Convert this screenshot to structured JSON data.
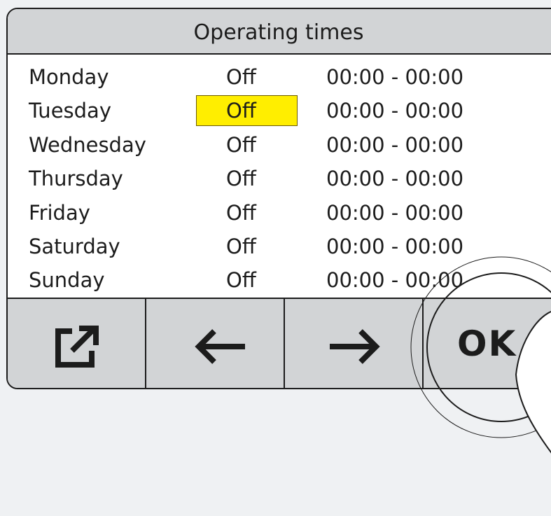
{
  "title": "Operating times",
  "schedule": [
    {
      "day": "Monday",
      "status": "Off",
      "time": "00:00 - 00:00",
      "selected": false
    },
    {
      "day": "Tuesday",
      "status": "Off",
      "time": "00:00 - 00:00",
      "selected": true
    },
    {
      "day": "Wednesday",
      "status": "Off",
      "time": "00:00 - 00:00",
      "selected": false
    },
    {
      "day": "Thursday",
      "status": "Off",
      "time": "00:00 - 00:00",
      "selected": false
    },
    {
      "day": "Friday",
      "status": "Off",
      "time": "00:00 - 00:00",
      "selected": false
    },
    {
      "day": "Saturday",
      "status": "Off",
      "time": "00:00 - 00:00",
      "selected": false
    },
    {
      "day": "Sunday",
      "status": "Off",
      "time": "00:00 - 00:00",
      "selected": false
    }
  ],
  "buttons": {
    "export_icon": "export-icon",
    "back_icon": "arrow-left-icon",
    "next_icon": "arrow-right-icon",
    "ok_label": "OK"
  },
  "colors": {
    "highlight": "#ffee00",
    "bar_background": "#d2d4d6",
    "outline": "#1c1c1c"
  }
}
